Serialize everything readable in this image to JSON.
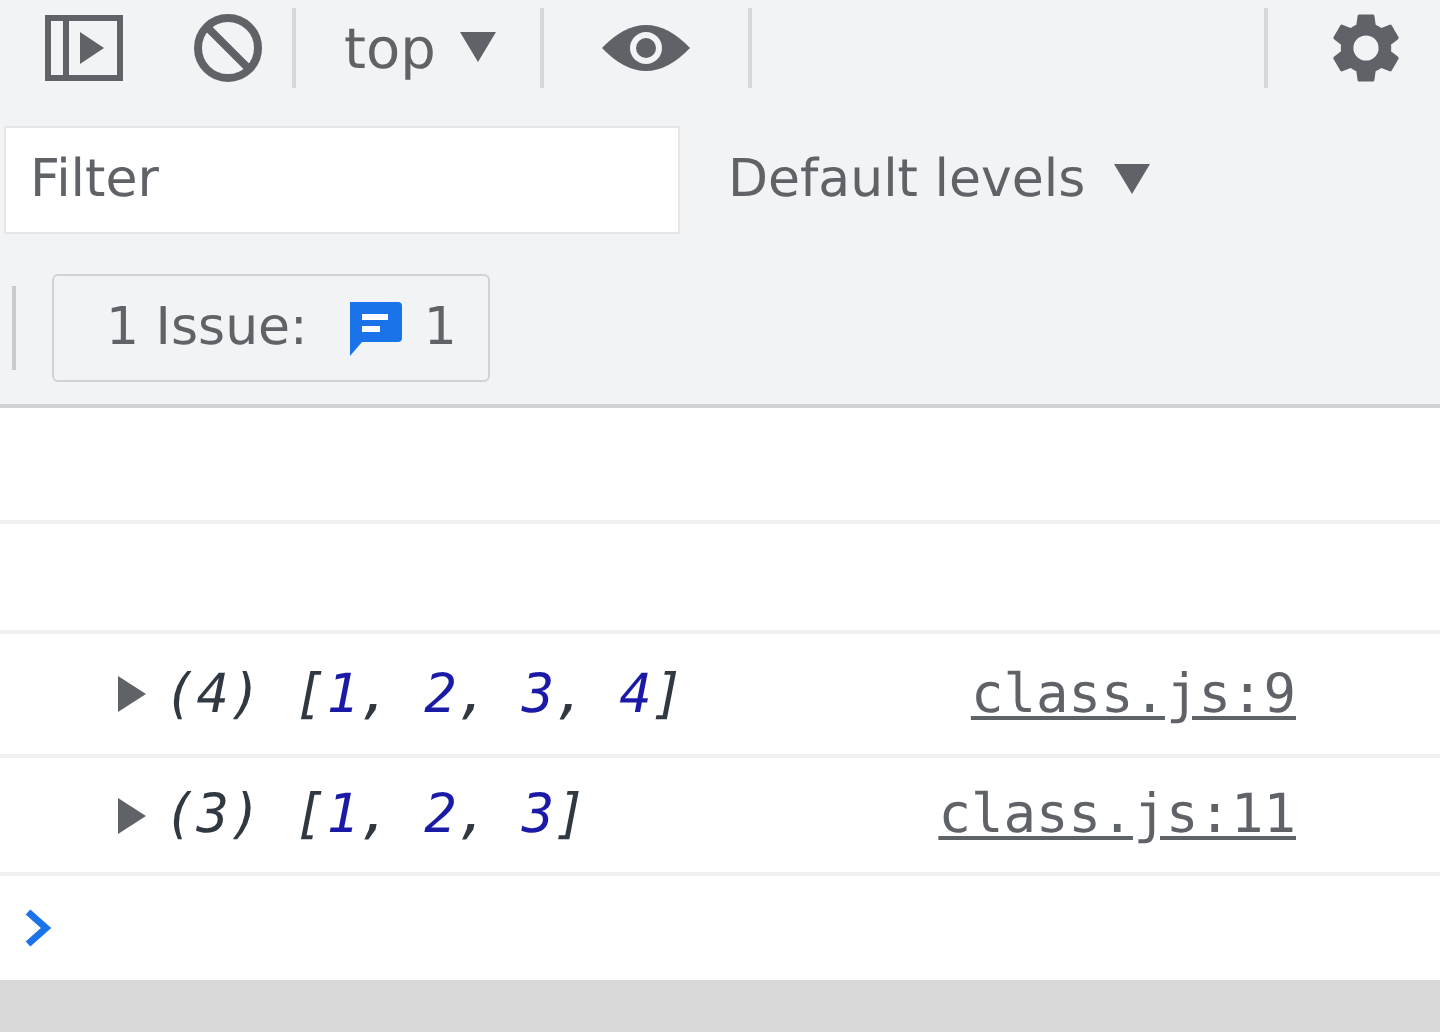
{
  "toolbar": {
    "context": "top",
    "live_expression_on": false
  },
  "filter": {
    "placeholder": "Filter"
  },
  "levels": {
    "label": "Default levels"
  },
  "issues": {
    "label": "1 Issue:",
    "count": "1"
  },
  "messages": [
    {
      "kind": "empty"
    },
    {
      "kind": "empty"
    },
    {
      "kind": "array",
      "expanded": false,
      "preview": [
        {
          "kind": "punct",
          "text": "(4) ["
        },
        {
          "kind": "number",
          "text": "1"
        },
        {
          "kind": "punct",
          "text": ", "
        },
        {
          "kind": "number",
          "text": "2"
        },
        {
          "kind": "punct",
          "text": ", "
        },
        {
          "kind": "number",
          "text": "3"
        },
        {
          "kind": "punct",
          "text": ", "
        },
        {
          "kind": "number",
          "text": "4"
        },
        {
          "kind": "punct",
          "text": "]"
        }
      ],
      "source": "class.js:9"
    },
    {
      "kind": "array",
      "expanded": false,
      "preview": [
        {
          "kind": "punct",
          "text": "(3) ["
        },
        {
          "kind": "number",
          "text": "1"
        },
        {
          "kind": "punct",
          "text": ", "
        },
        {
          "kind": "number",
          "text": "2"
        },
        {
          "kind": "punct",
          "text": ", "
        },
        {
          "kind": "number",
          "text": "3"
        },
        {
          "kind": "punct",
          "text": "]"
        }
      ],
      "source": "class.js:11"
    }
  ]
}
